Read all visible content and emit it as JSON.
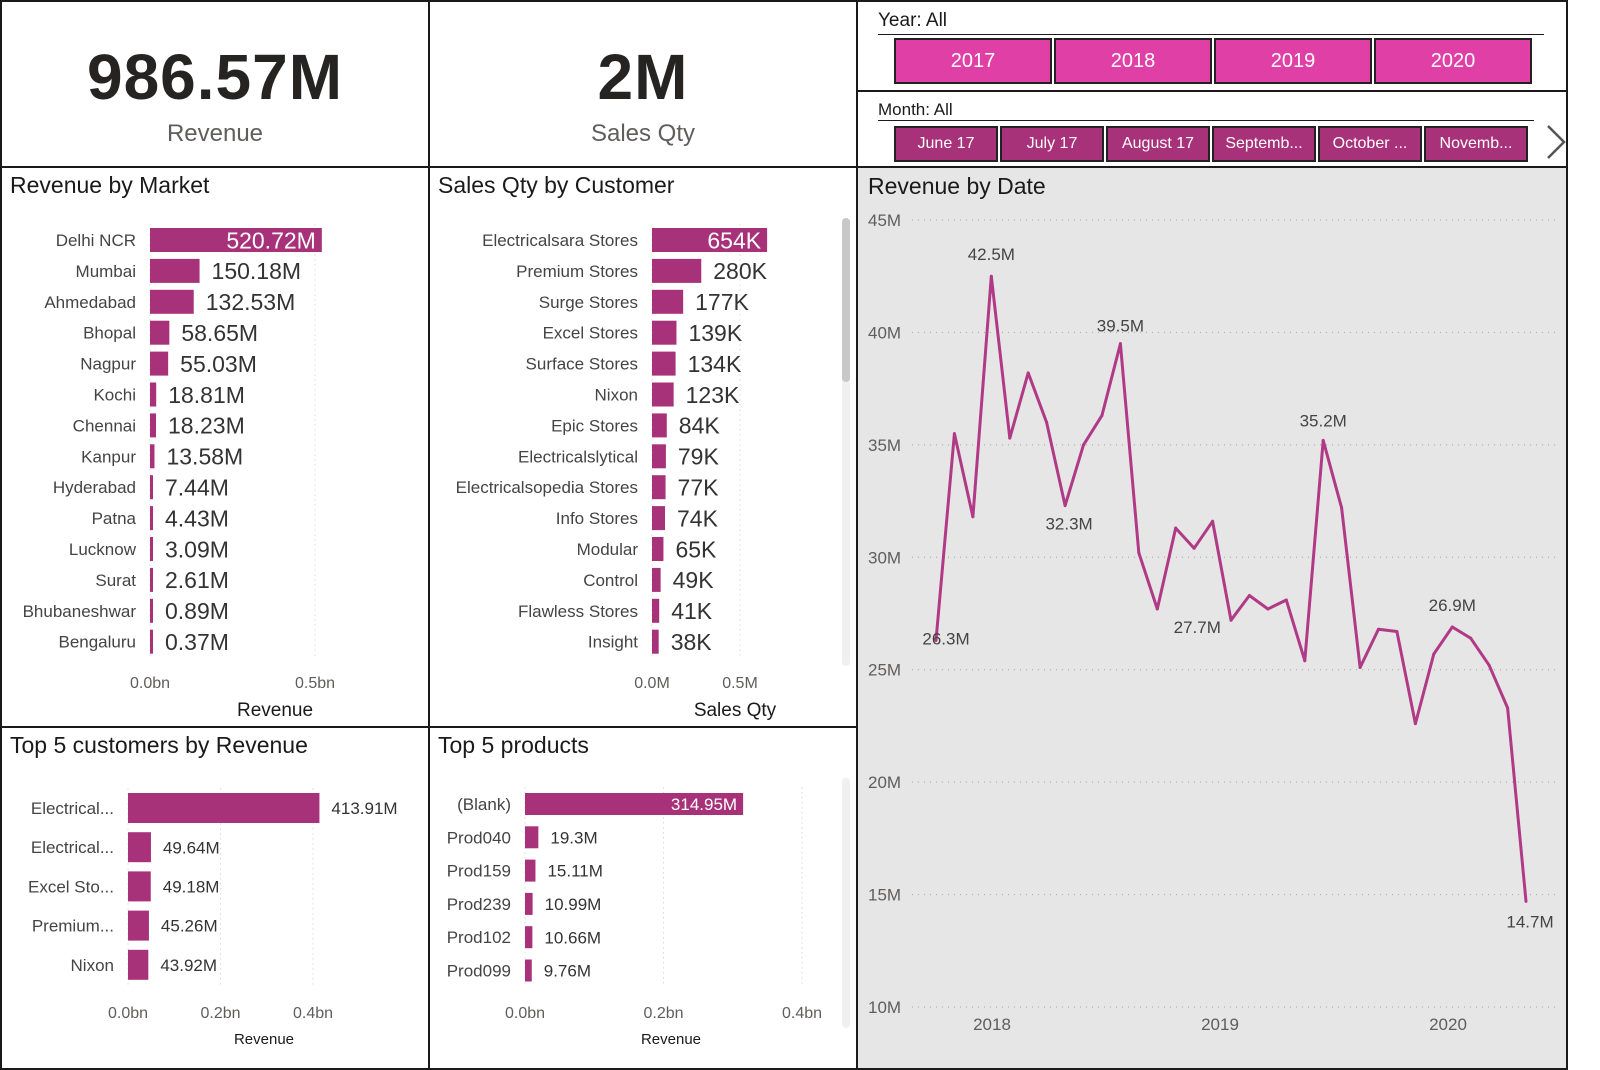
{
  "kpis": {
    "revenue": {
      "value": "986.57M",
      "label": "Revenue"
    },
    "sales_qty": {
      "value": "2M",
      "label": "Sales Qty"
    }
  },
  "slicers": {
    "year": {
      "title": "Year: All",
      "options": [
        "2017",
        "2018",
        "2019",
        "2020"
      ]
    },
    "month": {
      "title": "Month: All",
      "options": [
        "June 17",
        "July 17",
        "August 17",
        "Septemb...",
        "October ...",
        "Novemb..."
      ],
      "next_icon": "chevron-right-icon"
    }
  },
  "colors": {
    "bar": "#a8327a",
    "line": "#b03a86",
    "year_button": "#e040a5",
    "month_button": "#a8327a",
    "line_bg": "#e6e6e6"
  },
  "panels": {
    "revenue_by_market": "Revenue by Market",
    "sales_qty_by_customer": "Sales Qty by Customer",
    "top5_customers": "Top 5 customers by Revenue",
    "top5_products": "Top 5 products",
    "revenue_by_date": "Revenue by Date"
  },
  "chart_data": [
    {
      "id": "market",
      "type": "bar",
      "orientation": "horizontal",
      "title": "Revenue by Market",
      "xlabel": "Revenue",
      "xlim": [
        0,
        0.5
      ],
      "xticks": [
        "0.0bn",
        "0.5bn"
      ],
      "categories": [
        "Delhi NCR",
        "Mumbai",
        "Ahmedabad",
        "Bhopal",
        "Nagpur",
        "Kochi",
        "Chennai",
        "Kanpur",
        "Hyderabad",
        "Patna",
        "Lucknow",
        "Surat",
        "Bhubaneshwar",
        "Bengaluru"
      ],
      "values": [
        0.52072,
        0.15018,
        0.13253,
        0.05865,
        0.05503,
        0.01881,
        0.01823,
        0.01358,
        0.00744,
        0.00443,
        0.00309,
        0.00261,
        0.00089,
        0.00037
      ],
      "labels": [
        "520.72M",
        "150.18M",
        "132.53M",
        "58.65M",
        "55.03M",
        "18.81M",
        "18.23M",
        "13.58M",
        "7.44M",
        "4.43M",
        "3.09M",
        "2.61M",
        "0.89M",
        "0.37M"
      ]
    },
    {
      "id": "customer",
      "type": "bar",
      "orientation": "horizontal",
      "title": "Sales Qty by Customer",
      "xlabel": "Sales Qty",
      "xlim": [
        0,
        0.5
      ],
      "xticks": [
        "0.0M",
        "0.5M"
      ],
      "categories": [
        "Electricalsara Stores",
        "Premium Stores",
        "Surge Stores",
        "Excel Stores",
        "Surface Stores",
        "Nixon",
        "Epic Stores",
        "Electricalslytical",
        "Electricalsopedia Stores",
        "Info Stores",
        "Modular",
        "Control",
        "Flawless Stores",
        "Insight"
      ],
      "values": [
        0.654,
        0.28,
        0.177,
        0.139,
        0.134,
        0.123,
        0.084,
        0.079,
        0.077,
        0.074,
        0.065,
        0.049,
        0.041,
        0.038
      ],
      "labels": [
        "654K",
        "280K",
        "177K",
        "139K",
        "134K",
        "123K",
        "84K",
        "79K",
        "77K",
        "74K",
        "65K",
        "49K",
        "41K",
        "38K"
      ]
    },
    {
      "id": "top_customers",
      "type": "bar",
      "orientation": "horizontal",
      "title": "Top 5 customers by Revenue",
      "xlabel": "Revenue",
      "xlim": [
        0,
        0.4
      ],
      "xticks": [
        "0.0bn",
        "0.2bn",
        "0.4bn"
      ],
      "categories": [
        "Electrical...",
        "Electrical...",
        "Excel Sto...",
        "Premium...",
        "Nixon"
      ],
      "values": [
        0.41391,
        0.04964,
        0.04918,
        0.04526,
        0.04392
      ],
      "labels": [
        "413.91M",
        "49.64M",
        "49.18M",
        "45.26M",
        "43.92M"
      ]
    },
    {
      "id": "top_products",
      "type": "bar",
      "orientation": "horizontal",
      "title": "Top 5 products",
      "xlabel": "Revenue",
      "xlim": [
        0,
        0.4
      ],
      "xticks": [
        "0.0bn",
        "0.2bn",
        "0.4bn"
      ],
      "categories": [
        "(Blank)",
        "Prod040",
        "Prod159",
        "Prod239",
        "Prod102",
        "Prod099"
      ],
      "values": [
        0.31495,
        0.0193,
        0.01511,
        0.01099,
        0.01066,
        0.00976
      ],
      "labels": [
        "314.95M",
        "19.3M",
        "15.11M",
        "10.99M",
        "10.66M",
        "9.76M"
      ]
    },
    {
      "id": "date",
      "type": "line",
      "title": "Revenue by Date",
      "ylim": [
        10,
        45
      ],
      "yticks": [
        "10M",
        "15M",
        "20M",
        "25M",
        "30M",
        "35M",
        "40M",
        "45M"
      ],
      "xticks": [
        "2018",
        "2019",
        "2020"
      ],
      "x": [
        "2017-06",
        "2017-07",
        "2017-08",
        "2017-09",
        "2017-10",
        "2017-11",
        "2017-12",
        "2018-01",
        "2018-02",
        "2018-03",
        "2018-04",
        "2018-05",
        "2018-06",
        "2018-07",
        "2018-08",
        "2018-09",
        "2018-10",
        "2018-11",
        "2018-12",
        "2019-01",
        "2019-02",
        "2019-03",
        "2019-04",
        "2019-05",
        "2019-06",
        "2019-07",
        "2019-08",
        "2019-09",
        "2019-10",
        "2019-11",
        "2019-12",
        "2020-01",
        "2020-02",
        "2020-03",
        "2020-04",
        "2020-05",
        "2020-06"
      ],
      "values": [
        26.3,
        35.5,
        31.8,
        42.5,
        35.3,
        38.2,
        36.0,
        32.3,
        35.0,
        36.3,
        39.5,
        30.2,
        27.7,
        31.3,
        30.4,
        31.6,
        27.2,
        28.3,
        27.7,
        28.1,
        25.4,
        35.2,
        32.2,
        25.1,
        26.8,
        26.7,
        22.6,
        25.7,
        26.9,
        26.4,
        25.2,
        23.3,
        14.7
      ],
      "point_labels": [
        {
          "index": 0,
          "text": "26.3M"
        },
        {
          "index": 3,
          "text": "42.5M"
        },
        {
          "index": 7,
          "text": "32.3M"
        },
        {
          "index": 10,
          "text": "39.5M"
        },
        {
          "index": 12,
          "text": "27.7M"
        },
        {
          "index": 21,
          "text": "35.2M"
        },
        {
          "index": 28,
          "text": "26.9M"
        },
        {
          "index": 32,
          "text": "14.7M"
        }
      ]
    }
  ]
}
